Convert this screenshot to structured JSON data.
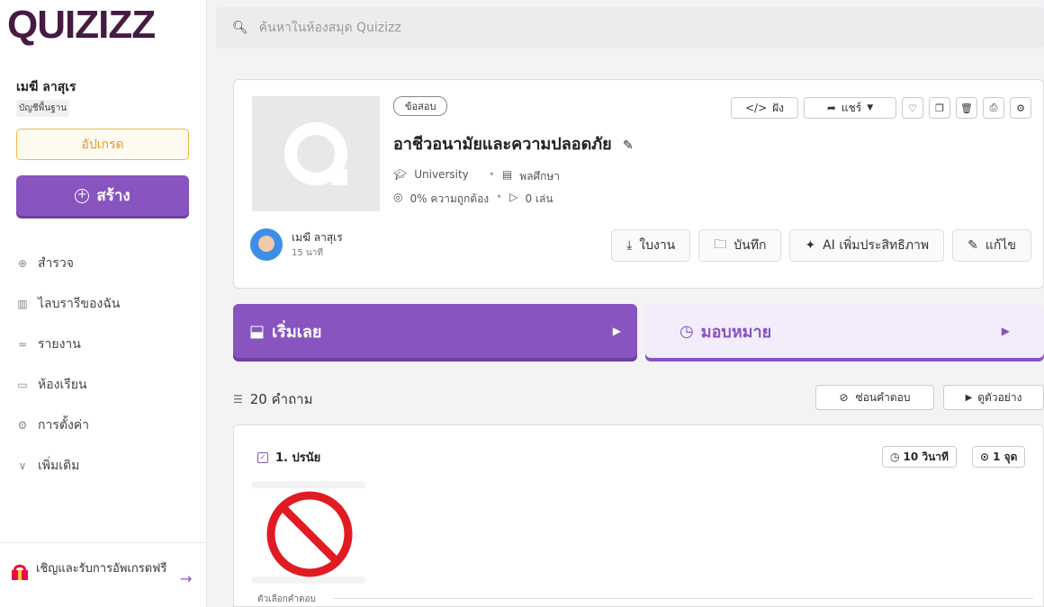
{
  "brand": {
    "logo_text": "QUIZIZZ",
    "logo_color": "#461a42",
    "accent": "#8854c0"
  },
  "sidebar": {
    "user_name": "เมฆี ลาสุเร",
    "plan": "บัญชีพื้นฐาน",
    "upgrade_label": "อัปเกรด",
    "create_label": "สร้าง",
    "items": [
      {
        "label": "สำรวจ",
        "icon": "explore-icon"
      },
      {
        "label": "ไลบรารีของฉัน",
        "icon": "library-icon"
      },
      {
        "label": "รายงาน",
        "icon": "reports-icon"
      },
      {
        "label": "ห้องเรียน",
        "icon": "classes-icon"
      },
      {
        "label": "การตั้งค่า",
        "icon": "settings-icon"
      },
      {
        "label": "เพิ่มเติม",
        "icon": "chevron-down-icon"
      }
    ],
    "invite_text": "เชิญและรับการอัพเกรดฟรี"
  },
  "search": {
    "placeholder": "ค้นหาในห้องสมุด Quizizz"
  },
  "quiz": {
    "type_tag": "ข้อสอบ",
    "title": "อาชีวอนามัยและความปลอดภัย",
    "level": "University",
    "subject": "พลศึกษา",
    "accuracy": "0% ความถูกต้อง",
    "plays": "0 เล่น",
    "author_name": "เมฆี ลาสุเร",
    "author_time": "15 นาที",
    "top_actions": {
      "embed": "ฝัง",
      "share": "แชร์"
    },
    "bottom_actions": {
      "worksheet": "ใบงาน",
      "save": "บันทึก",
      "ai_enhance": "AI เพิ่มประสิทธิภาพ",
      "edit": "แก้ไข"
    }
  },
  "main": {
    "start_label": "เริ่มเลย",
    "assign_label": "มอบหมาย",
    "question_count": "20 คำถาม",
    "hide_answers": "ซ่อนคำตอบ",
    "preview": "ดูตัวอย่าง"
  },
  "question": {
    "type_label": "1. ปรนัย",
    "time": "10 วินาที",
    "points": "1 จุด",
    "answers_label": "ตัวเลือกคำตอบ"
  }
}
